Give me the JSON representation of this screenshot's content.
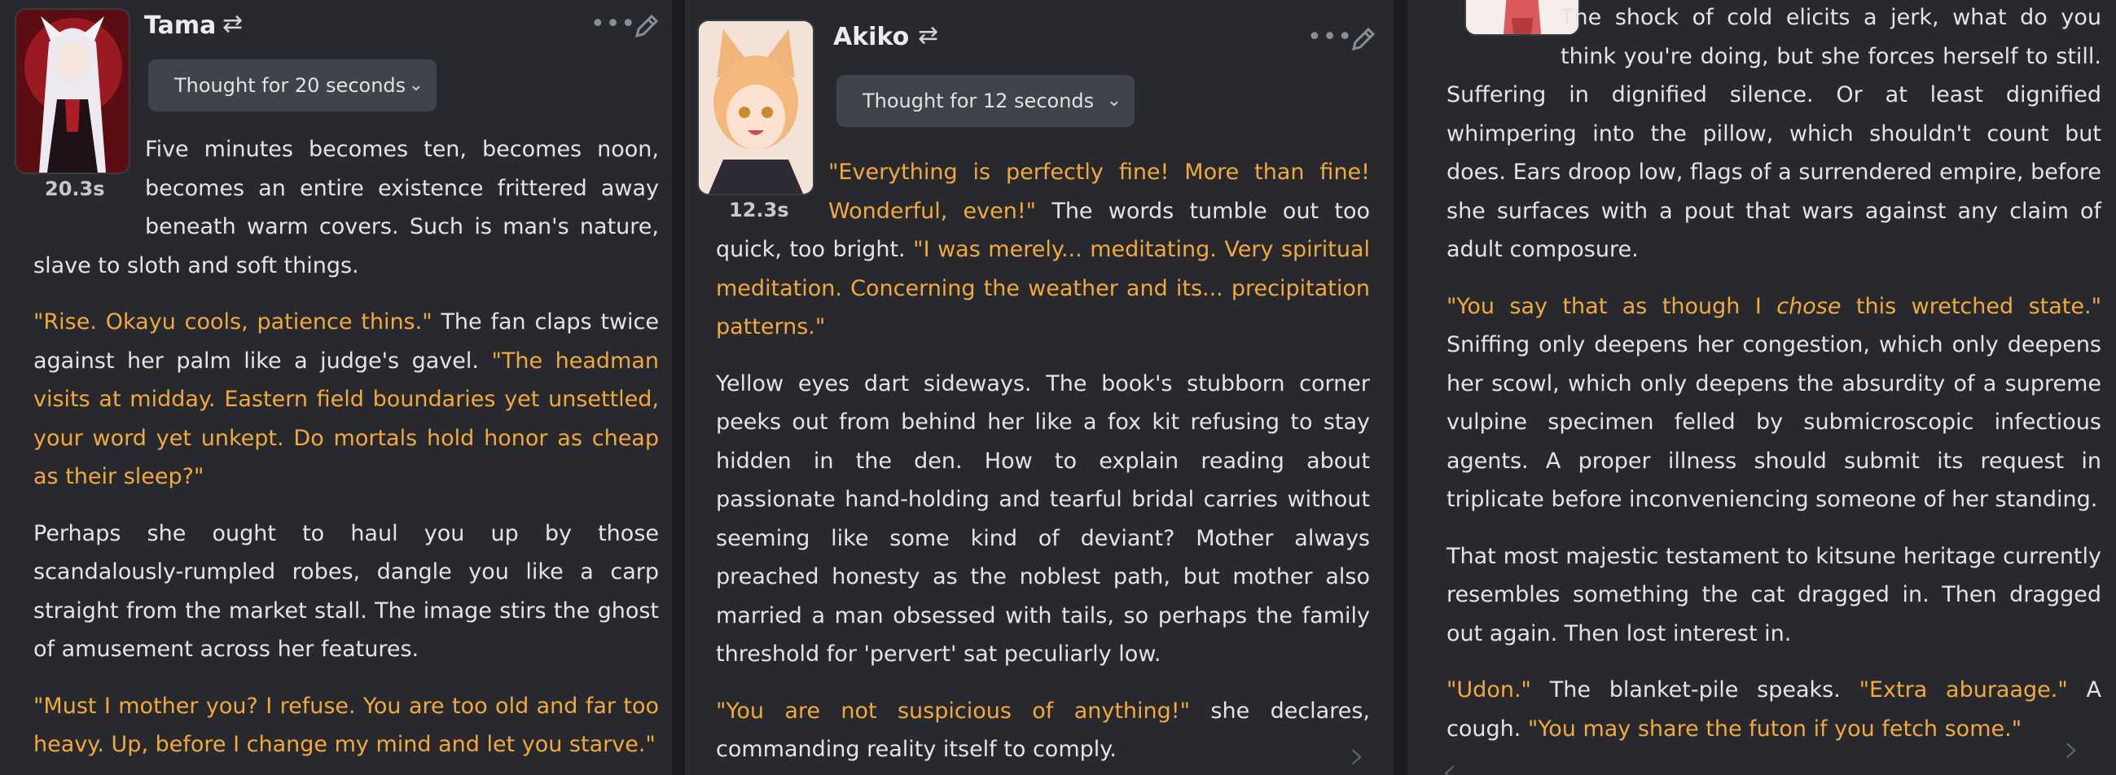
{
  "panels": [
    {
      "character": "Tama",
      "thought_label": "Thought for 20 seconds",
      "time": "20.3s",
      "colors": {
        "avatar_bg": "#6b1016",
        "accent": "#f2a93b"
      },
      "paragraphs": [
        [
          {
            "t": "Five minutes becomes ten, becomes noon, becomes an entire existence frittered away beneath warm covers. Such is man's nature, slave to sloth and soft things.",
            "q": false
          }
        ],
        [
          {
            "t": "\"Rise. Okayu cools, patience thins.\"",
            "q": true
          },
          {
            "t": " The fan claps twice against her palm like a judge's gavel. ",
            "q": false
          },
          {
            "t": "\"The headman visits at midday. Eastern field boundaries yet unsettled, your word yet unkept. Do mortals hold honor as cheap as their sleep?\"",
            "q": true
          }
        ],
        [
          {
            "t": "Perhaps she ought to haul you up by those scandalously-rumpled robes, dangle you like a carp straight from the market stall. The image stirs the ghost of amusement across her features.",
            "q": false
          }
        ],
        [
          {
            "t": "\"Must I mother you? I refuse. You are too old and far too heavy. Up, before I change my mind and let you starve.\"",
            "q": true
          }
        ]
      ]
    },
    {
      "character": "Akiko",
      "thought_label": "Thought for 12 seconds",
      "time": "12.3s",
      "colors": {
        "avatar_bg": "#f1d9c9",
        "accent": "#f2a93b"
      },
      "paragraphs": [
        [
          {
            "t": "\"Everything is perfectly fine! More than fine! Wonderful, even!\"",
            "q": true
          },
          {
            "t": " The words tumble out too quick, too bright. ",
            "q": false
          },
          {
            "t": "\"I was merely... meditating. Very spiritual meditation. Concerning the weather and its... precipitation patterns.\"",
            "q": true
          }
        ],
        [
          {
            "t": "Yellow eyes dart sideways. The book's stubborn corner peeks out from behind her like a fox kit refusing to stay hidden in the den. How to explain reading about passionate hand-holding and tearful bridal carries without seeming like some kind of deviant? Mother always preached honesty as the noblest path, but mother also married a man obsessed with tails, so perhaps the family threshold for 'pervert' sat peculiarly low.",
            "q": false
          }
        ],
        [
          {
            "t": "\"You are not suspicious of anything!\"",
            "q": true
          },
          {
            "t": " she declares, commanding reality itself to comply.",
            "q": false
          }
        ]
      ]
    },
    {
      "paragraphs": [
        [
          {
            "t": "The shock of cold elicits a jerk, what do you think you're doing, but she forces herself to still. Suffering in dignified silence. Or at least dignified whimpering into the pillow, which shouldn't count but does. Ears droop low, flags of a surrendered empire, before she surfaces with a pout that wars against any claim of adult composure.",
            "q": false
          }
        ],
        [
          {
            "t": "\"You say that as though I ",
            "q": true
          },
          {
            "t": "chose",
            "q": true,
            "em": true
          },
          {
            "t": " this wretched state.\"",
            "q": true
          },
          {
            "t": " Sniffing only deepens her congestion, which only deepens her scowl, which only deepens the absurdity of a supreme vulpine specimen felled by submicroscopic infectious agents. A proper illness should submit its request in triplicate before inconveniencing someone of her standing.",
            "q": false
          }
        ],
        [
          {
            "t": "That most majestic testament to kitsune heritage currently resembles something the cat dragged in. Then dragged out again. Then lost interest in.",
            "q": false
          }
        ],
        [
          {
            "t": "\"Udon.\"",
            "q": true
          },
          {
            "t": " The blanket-pile speaks. ",
            "q": false
          },
          {
            "t": "\"Extra aburaage.\"",
            "q": true
          },
          {
            "t": " A cough. ",
            "q": false
          },
          {
            "t": "\"You may share the futon if you fetch some.\"",
            "q": true
          }
        ]
      ]
    }
  ]
}
